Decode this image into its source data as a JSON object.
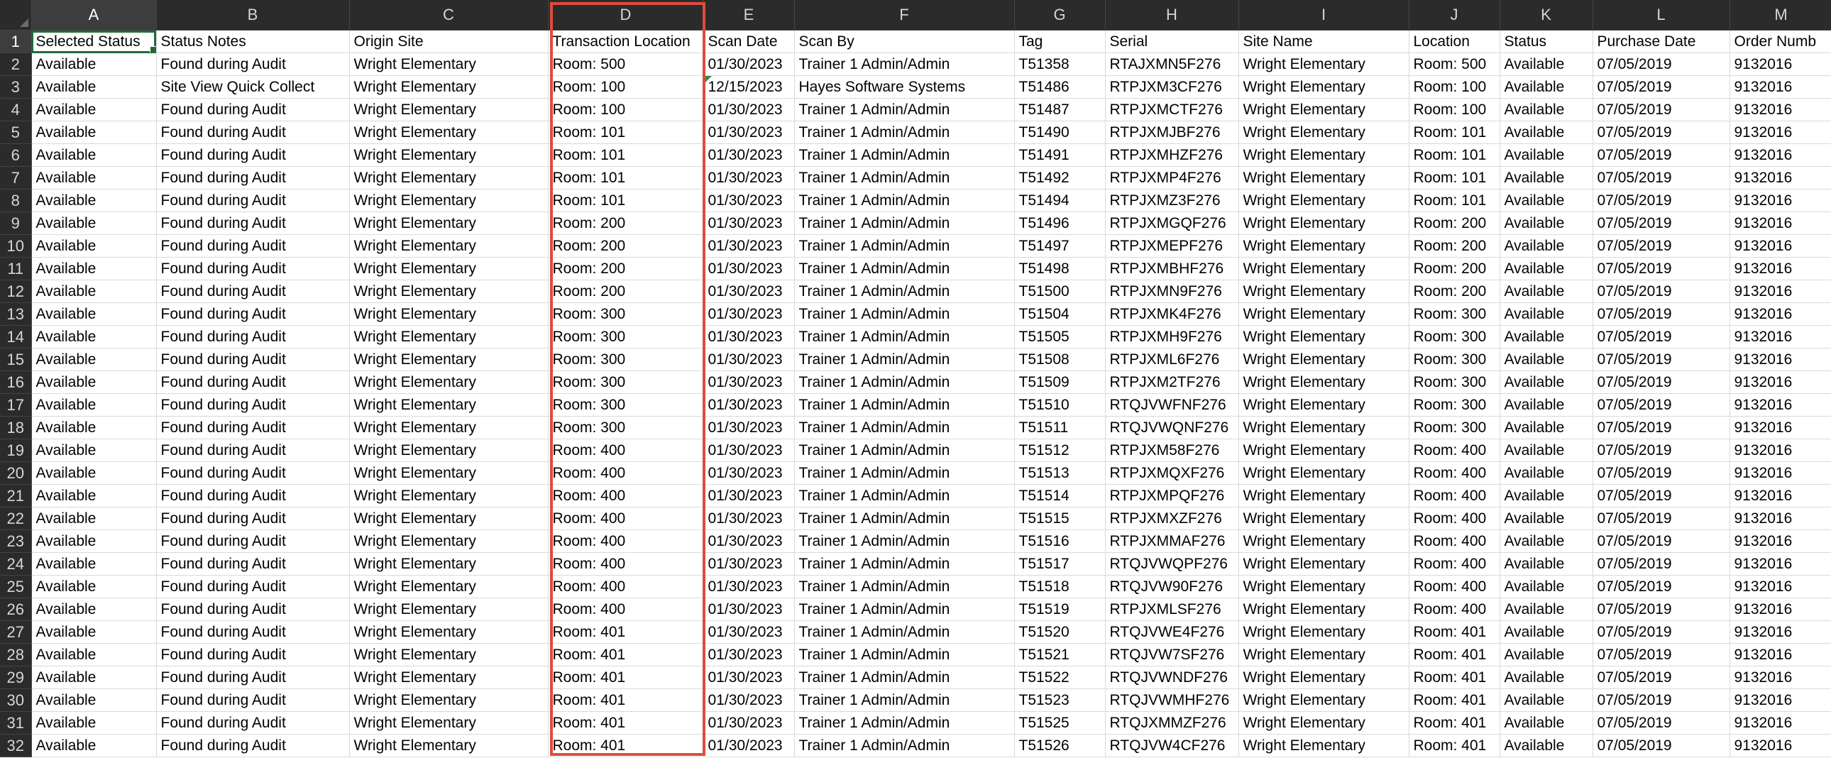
{
  "spreadsheet": {
    "columns": [
      "A",
      "B",
      "C",
      "D",
      "E",
      "F",
      "G",
      "H",
      "I",
      "J",
      "K",
      "L",
      "M"
    ],
    "headers": [
      "Selected Status",
      "Status Notes",
      "Origin Site",
      "Transaction Location",
      "Scan Date",
      "Scan By",
      "Tag",
      "Serial",
      "Site Name",
      "Location",
      "Status",
      "Purchase Date",
      "Order Numb"
    ],
    "rows": [
      [
        "Available",
        "Found during Audit",
        "Wright Elementary",
        "Room: 500",
        "01/30/2023",
        "Trainer 1 Admin/Admin",
        "T51358",
        "RTAJXMN5F276",
        "Wright Elementary",
        "Room: 500",
        "Available",
        "07/05/2019",
        "9132016"
      ],
      [
        "Available",
        "Site View Quick Collect",
        "Wright Elementary",
        "Room: 100",
        "12/15/2023",
        "Hayes Software Systems",
        "T51486",
        "RTPJXM3CF276",
        "Wright Elementary",
        "Room: 100",
        "Available",
        "07/05/2019",
        "9132016"
      ],
      [
        "Available",
        "Found during Audit",
        "Wright Elementary",
        "Room: 100",
        "01/30/2023",
        "Trainer 1 Admin/Admin",
        "T51487",
        "RTPJXMCTF276",
        "Wright Elementary",
        "Room: 100",
        "Available",
        "07/05/2019",
        "9132016"
      ],
      [
        "Available",
        "Found during Audit",
        "Wright Elementary",
        "Room: 101",
        "01/30/2023",
        "Trainer 1 Admin/Admin",
        "T51490",
        "RTPJXMJBF276",
        "Wright Elementary",
        "Room: 101",
        "Available",
        "07/05/2019",
        "9132016"
      ],
      [
        "Available",
        "Found during Audit",
        "Wright Elementary",
        "Room: 101",
        "01/30/2023",
        "Trainer 1 Admin/Admin",
        "T51491",
        "RTPJXMHZF276",
        "Wright Elementary",
        "Room: 101",
        "Available",
        "07/05/2019",
        "9132016"
      ],
      [
        "Available",
        "Found during Audit",
        "Wright Elementary",
        "Room: 101",
        "01/30/2023",
        "Trainer 1 Admin/Admin",
        "T51492",
        "RTPJXMP4F276",
        "Wright Elementary",
        "Room: 101",
        "Available",
        "07/05/2019",
        "9132016"
      ],
      [
        "Available",
        "Found during Audit",
        "Wright Elementary",
        "Room: 101",
        "01/30/2023",
        "Trainer 1 Admin/Admin",
        "T51494",
        "RTPJXMZ3F276",
        "Wright Elementary",
        "Room: 101",
        "Available",
        "07/05/2019",
        "9132016"
      ],
      [
        "Available",
        "Found during Audit",
        "Wright Elementary",
        "Room: 200",
        "01/30/2023",
        "Trainer 1 Admin/Admin",
        "T51496",
        "RTPJXMGQF276",
        "Wright Elementary",
        "Room: 200",
        "Available",
        "07/05/2019",
        "9132016"
      ],
      [
        "Available",
        "Found during Audit",
        "Wright Elementary",
        "Room: 200",
        "01/30/2023",
        "Trainer 1 Admin/Admin",
        "T51497",
        "RTPJXMEPF276",
        "Wright Elementary",
        "Room: 200",
        "Available",
        "07/05/2019",
        "9132016"
      ],
      [
        "Available",
        "Found during Audit",
        "Wright Elementary",
        "Room: 200",
        "01/30/2023",
        "Trainer 1 Admin/Admin",
        "T51498",
        "RTPJXMBHF276",
        "Wright Elementary",
        "Room: 200",
        "Available",
        "07/05/2019",
        "9132016"
      ],
      [
        "Available",
        "Found during Audit",
        "Wright Elementary",
        "Room: 200",
        "01/30/2023",
        "Trainer 1 Admin/Admin",
        "T51500",
        "RTPJXMN9F276",
        "Wright Elementary",
        "Room: 200",
        "Available",
        "07/05/2019",
        "9132016"
      ],
      [
        "Available",
        "Found during Audit",
        "Wright Elementary",
        "Room: 300",
        "01/30/2023",
        "Trainer 1 Admin/Admin",
        "T51504",
        "RTPJXMK4F276",
        "Wright Elementary",
        "Room: 300",
        "Available",
        "07/05/2019",
        "9132016"
      ],
      [
        "Available",
        "Found during Audit",
        "Wright Elementary",
        "Room: 300",
        "01/30/2023",
        "Trainer 1 Admin/Admin",
        "T51505",
        "RTPJXMH9F276",
        "Wright Elementary",
        "Room: 300",
        "Available",
        "07/05/2019",
        "9132016"
      ],
      [
        "Available",
        "Found during Audit",
        "Wright Elementary",
        "Room: 300",
        "01/30/2023",
        "Trainer 1 Admin/Admin",
        "T51508",
        "RTPJXML6F276",
        "Wright Elementary",
        "Room: 300",
        "Available",
        "07/05/2019",
        "9132016"
      ],
      [
        "Available",
        "Found during Audit",
        "Wright Elementary",
        "Room: 300",
        "01/30/2023",
        "Trainer 1 Admin/Admin",
        "T51509",
        "RTPJXM2TF276",
        "Wright Elementary",
        "Room: 300",
        "Available",
        "07/05/2019",
        "9132016"
      ],
      [
        "Available",
        "Found during Audit",
        "Wright Elementary",
        "Room: 300",
        "01/30/2023",
        "Trainer 1 Admin/Admin",
        "T51510",
        "RTQJVWFNF276",
        "Wright Elementary",
        "Room: 300",
        "Available",
        "07/05/2019",
        "9132016"
      ],
      [
        "Available",
        "Found during Audit",
        "Wright Elementary",
        "Room: 300",
        "01/30/2023",
        "Trainer 1 Admin/Admin",
        "T51511",
        "RTQJVWQNF276",
        "Wright Elementary",
        "Room: 300",
        "Available",
        "07/05/2019",
        "9132016"
      ],
      [
        "Available",
        "Found during Audit",
        "Wright Elementary",
        "Room: 400",
        "01/30/2023",
        "Trainer 1 Admin/Admin",
        "T51512",
        "RTPJXM58F276",
        "Wright Elementary",
        "Room: 400",
        "Available",
        "07/05/2019",
        "9132016"
      ],
      [
        "Available",
        "Found during Audit",
        "Wright Elementary",
        "Room: 400",
        "01/30/2023",
        "Trainer 1 Admin/Admin",
        "T51513",
        "RTPJXMQXF276",
        "Wright Elementary",
        "Room: 400",
        "Available",
        "07/05/2019",
        "9132016"
      ],
      [
        "Available",
        "Found during Audit",
        "Wright Elementary",
        "Room: 400",
        "01/30/2023",
        "Trainer 1 Admin/Admin",
        "T51514",
        "RTPJXMPQF276",
        "Wright Elementary",
        "Room: 400",
        "Available",
        "07/05/2019",
        "9132016"
      ],
      [
        "Available",
        "Found during Audit",
        "Wright Elementary",
        "Room: 400",
        "01/30/2023",
        "Trainer 1 Admin/Admin",
        "T51515",
        "RTPJXMXZF276",
        "Wright Elementary",
        "Room: 400",
        "Available",
        "07/05/2019",
        "9132016"
      ],
      [
        "Available",
        "Found during Audit",
        "Wright Elementary",
        "Room: 400",
        "01/30/2023",
        "Trainer 1 Admin/Admin",
        "T51516",
        "RTPJXMMAF276",
        "Wright Elementary",
        "Room: 400",
        "Available",
        "07/05/2019",
        "9132016"
      ],
      [
        "Available",
        "Found during Audit",
        "Wright Elementary",
        "Room: 400",
        "01/30/2023",
        "Trainer 1 Admin/Admin",
        "T51517",
        "RTQJVWQPF276",
        "Wright Elementary",
        "Room: 400",
        "Available",
        "07/05/2019",
        "9132016"
      ],
      [
        "Available",
        "Found during Audit",
        "Wright Elementary",
        "Room: 400",
        "01/30/2023",
        "Trainer 1 Admin/Admin",
        "T51518",
        "RTQJVW90F276",
        "Wright Elementary",
        "Room: 400",
        "Available",
        "07/05/2019",
        "9132016"
      ],
      [
        "Available",
        "Found during Audit",
        "Wright Elementary",
        "Room: 400",
        "01/30/2023",
        "Trainer 1 Admin/Admin",
        "T51519",
        "RTPJXMLSF276",
        "Wright Elementary",
        "Room: 400",
        "Available",
        "07/05/2019",
        "9132016"
      ],
      [
        "Available",
        "Found during Audit",
        "Wright Elementary",
        "Room: 401",
        "01/30/2023",
        "Trainer 1 Admin/Admin",
        "T51520",
        "RTQJVWE4F276",
        "Wright Elementary",
        "Room: 401",
        "Available",
        "07/05/2019",
        "9132016"
      ],
      [
        "Available",
        "Found during Audit",
        "Wright Elementary",
        "Room: 401",
        "01/30/2023",
        "Trainer 1 Admin/Admin",
        "T51521",
        "RTQJVW7SF276",
        "Wright Elementary",
        "Room: 401",
        "Available",
        "07/05/2019",
        "9132016"
      ],
      [
        "Available",
        "Found during Audit",
        "Wright Elementary",
        "Room: 401",
        "01/30/2023",
        "Trainer 1 Admin/Admin",
        "T51522",
        "RTQJVWNDF276",
        "Wright Elementary",
        "Room: 401",
        "Available",
        "07/05/2019",
        "9132016"
      ],
      [
        "Available",
        "Found during Audit",
        "Wright Elementary",
        "Room: 401",
        "01/30/2023",
        "Trainer 1 Admin/Admin",
        "T51523",
        "RTQJVWMHF276",
        "Wright Elementary",
        "Room: 401",
        "Available",
        "07/05/2019",
        "9132016"
      ],
      [
        "Available",
        "Found during Audit",
        "Wright Elementary",
        "Room: 401",
        "01/30/2023",
        "Trainer 1 Admin/Admin",
        "T51525",
        "RTQJXMMZF276",
        "Wright Elementary",
        "Room: 401",
        "Available",
        "07/05/2019",
        "9132016"
      ],
      [
        "Available",
        "Found during Audit",
        "Wright Elementary",
        "Room: 401",
        "01/30/2023",
        "Trainer 1 Admin/Admin",
        "T51526",
        "RTQJVW4CF276",
        "Wright Elementary",
        "Room: 401",
        "Available",
        "07/05/2019",
        "9132016"
      ]
    ],
    "selected_cell": "A1",
    "highlighted_column": "D",
    "colors": {
      "header_bg": "#2b2b2b",
      "header_text": "#d6d6d6",
      "selection_border": "#1e6b38",
      "highlight_box": "#e04b3f",
      "gridline": "#d9d9d9"
    }
  }
}
